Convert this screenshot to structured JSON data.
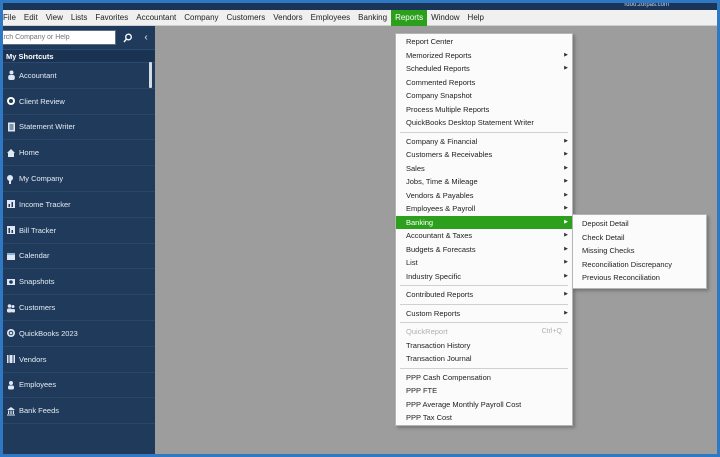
{
  "titlebar": {
    "user": "rdoo.zorpas.com"
  },
  "menubar": {
    "items": [
      "File",
      "Edit",
      "View",
      "Lists",
      "Favorites",
      "Accountant",
      "Company",
      "Customers",
      "Vendors",
      "Employees",
      "Banking",
      "Reports",
      "Window",
      "Help"
    ],
    "active": "Reports"
  },
  "sidebar": {
    "search_placeholder": "Search Company or Help",
    "search_icon": "search-icon",
    "collapse_icon": "chevron-left-icon",
    "header": "My Shortcuts",
    "shortcuts": [
      {
        "label": "Accountant",
        "icon": "person-icon"
      },
      {
        "label": "Client Review",
        "icon": "review-icon"
      },
      {
        "label": "Statement Writer",
        "icon": "statement-icon"
      },
      {
        "label": "Home",
        "icon": "home-icon"
      },
      {
        "label": "My Company",
        "icon": "company-icon"
      },
      {
        "label": "Income Tracker",
        "icon": "tracker-icon"
      },
      {
        "label": "Bill Tracker",
        "icon": "bill-icon"
      },
      {
        "label": "Calendar",
        "icon": "calendar-icon"
      },
      {
        "label": "Snapshots",
        "icon": "snapshot-icon"
      },
      {
        "label": "Customers",
        "icon": "customers-icon"
      },
      {
        "label": "QuickBooks 2023",
        "icon": "quickbooks-icon"
      },
      {
        "label": "Vendors",
        "icon": "vendors-icon"
      },
      {
        "label": "Employees",
        "icon": "employees-icon"
      },
      {
        "label": "Bank Feeds",
        "icon": "bank-icon"
      }
    ]
  },
  "reports_menu": {
    "group1": [
      {
        "label": "Report Center",
        "arrow": false
      },
      {
        "label": "Memorized Reports",
        "arrow": true
      },
      {
        "label": "Scheduled Reports",
        "arrow": true
      },
      {
        "label": "Commented Reports",
        "arrow": false
      },
      {
        "label": "Company Snapshot",
        "arrow": false
      },
      {
        "label": "Process Multiple Reports",
        "arrow": false
      },
      {
        "label": "QuickBooks Desktop Statement Writer",
        "arrow": false
      }
    ],
    "group2": [
      {
        "label": "Company & Financial",
        "arrow": true
      },
      {
        "label": "Customers & Receivables",
        "arrow": true
      },
      {
        "label": "Sales",
        "arrow": true
      },
      {
        "label": "Jobs, Time & Mileage",
        "arrow": true
      },
      {
        "label": "Vendors & Payables",
        "arrow": true
      },
      {
        "label": "Employees & Payroll",
        "arrow": true
      },
      {
        "label": "Banking",
        "arrow": true
      },
      {
        "label": "Accountant & Taxes",
        "arrow": true
      },
      {
        "label": "Budgets & Forecasts",
        "arrow": true
      },
      {
        "label": "List",
        "arrow": true
      },
      {
        "label": "Industry Specific",
        "arrow": true
      }
    ],
    "contributed": "Contributed Reports",
    "custom": "Custom Reports",
    "quickreport": {
      "label": "QuickReport",
      "shortcut": "Ctrl+Q"
    },
    "transaction_history": "Transaction History",
    "transaction_journal": "Transaction Journal",
    "ppp": [
      "PPP Cash Compensation",
      "PPP FTE",
      "PPP Average Monthly Payroll Cost",
      "PPP Tax Cost"
    ],
    "highlighted": "Banking"
  },
  "banking_submenu": {
    "items": [
      "Deposit Detail",
      "Check Detail",
      "Missing Checks",
      "Reconciliation Discrepancy",
      "Previous Reconciliation"
    ]
  },
  "colors": {
    "sidebar": "#1f3a5a",
    "menu_highlight": "#2ca01c",
    "window_border": "#2e78c4",
    "workspace": "#9d9d9d"
  }
}
